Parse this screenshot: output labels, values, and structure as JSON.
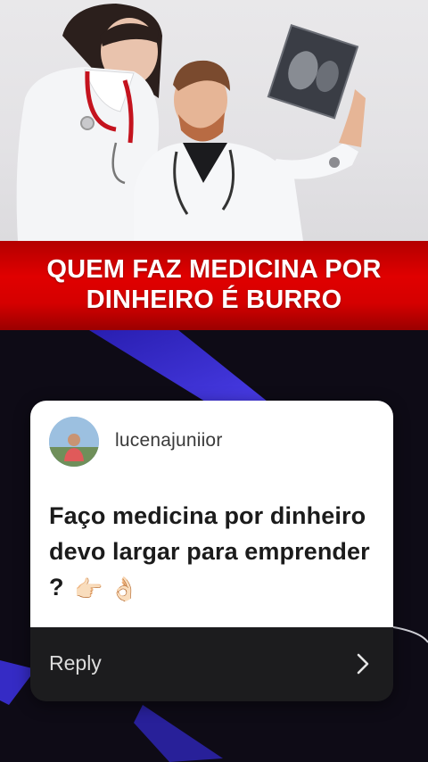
{
  "banner": {
    "title": "QUEM FAZ MEDICINA POR DINHEIRO É BURRO"
  },
  "card": {
    "username": "lucenajuniior",
    "question": "Faço medicina por dinheiro devo largar para emprender ?",
    "emojis": "👉🏻 👌🏻",
    "reply_label": "Reply",
    "reply_icon": "chevron-right-icon"
  },
  "colors": {
    "banner_red": "#e00000",
    "card_bg": "#ffffff",
    "reply_bar_bg": "#1c1c1e",
    "page_bg": "#0e0b16",
    "accent_blue": "#3a2fd8"
  }
}
